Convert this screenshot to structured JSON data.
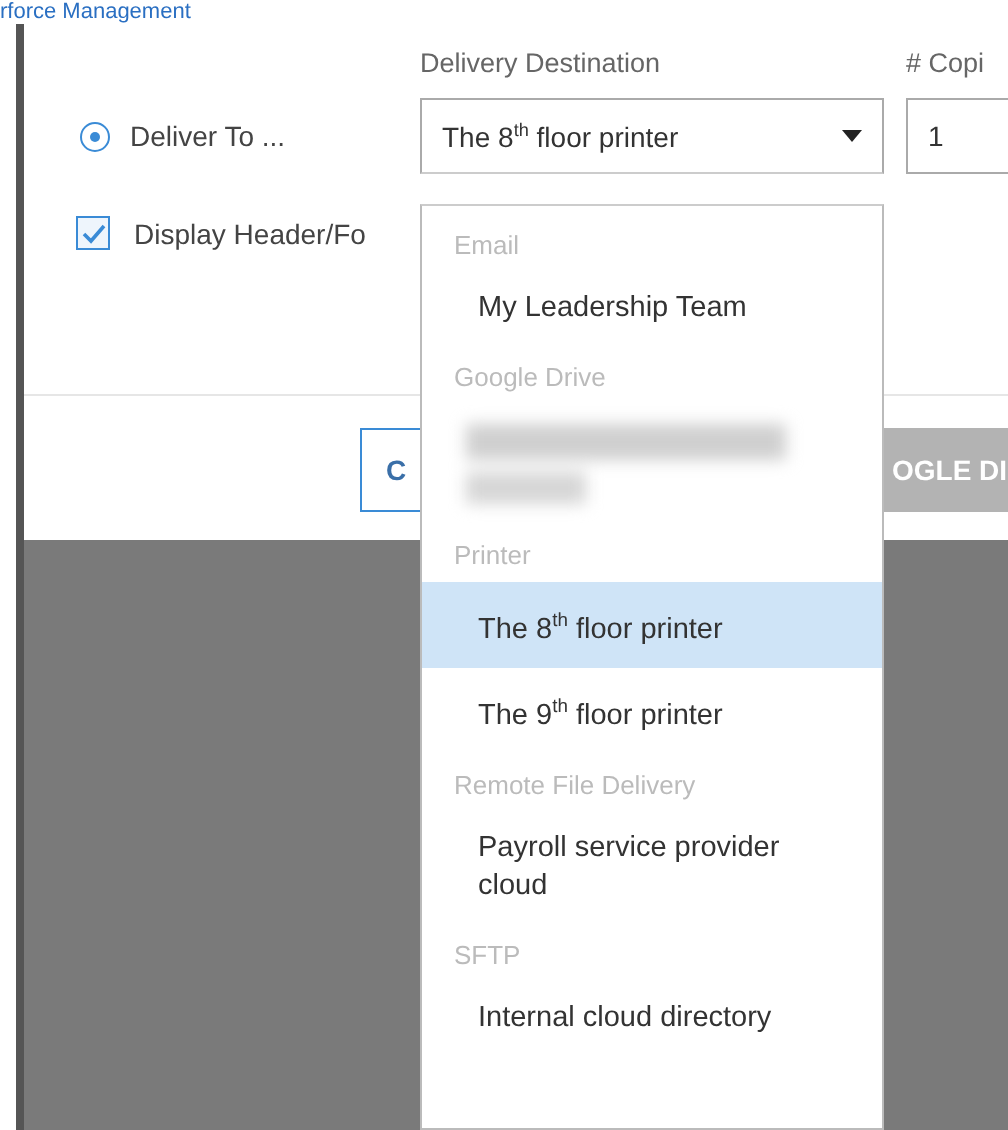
{
  "breadcrumb": "rforce Management",
  "dialog": {
    "destination_label": "Delivery Destination",
    "copies_label": "# Copi",
    "deliver_option": {
      "label": "Deliver To ...",
      "selected": true
    },
    "destination_select": {
      "value": "The 8$^{th}$ floor printer",
      "expanded": true
    },
    "copies_field": {
      "value": "1"
    },
    "header_footer": {
      "label": "Display Header/Fo",
      "checked": true
    },
    "buttons": [
      {
        "label": "C",
        "kind": "outline"
      },
      {
        "label": "OGLE DI",
        "kind": "filled"
      }
    ]
  },
  "dropdown": [
    {
      "group": "Email",
      "items": [
        {
          "label": "My Leadership Team",
          "selected": false
        }
      ]
    },
    {
      "group": "Google Drive",
      "items": [
        {
          "kind": "blurred",
          "selected": false
        }
      ]
    },
    {
      "group": "Printer",
      "items": [
        {
          "label": "The 8$^{th}$ floor printer",
          "selected": true
        },
        {
          "label": "The 9$^{th}$ floor printer",
          "selected": false
        }
      ]
    },
    {
      "group": "Remote File Delivery",
      "items": [
        {
          "label": "Payroll service provider cloud",
          "selected": false
        }
      ]
    },
    {
      "group": "SFTP",
      "items": [
        {
          "label": "Internal cloud directory",
          "selected": false
        }
      ]
    }
  ]
}
